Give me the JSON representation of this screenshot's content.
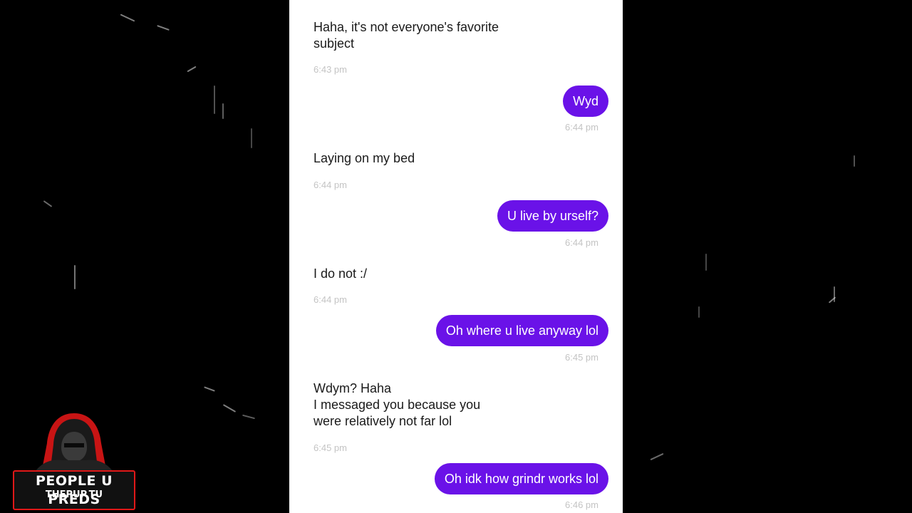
{
  "conversation": {
    "top_time": "",
    "messages": [
      {
        "direction": "in",
        "text": "Haha, it's not everyone's favorite\nsubject",
        "time": "6:43 pm"
      },
      {
        "direction": "out",
        "text": "Wyd",
        "time": "6:44 pm"
      },
      {
        "direction": "in",
        "text": "Laying on my bed",
        "time": "6:44 pm"
      },
      {
        "direction": "out",
        "text": "U live by urself?",
        "time": "6:44 pm"
      },
      {
        "direction": "in",
        "text": "I do not :/",
        "time": "6:44 pm"
      },
      {
        "direction": "out",
        "text": "Oh where u live anyway lol",
        "time": "6:45 pm"
      },
      {
        "direction": "in",
        "text": "Wdym? Haha\nI messaged you because you\nwere relatively not far lol",
        "time": "6:45 pm"
      },
      {
        "direction": "out",
        "text": "Oh idk how grindr works lol",
        "time": "6:46 pm"
      }
    ]
  },
  "colors": {
    "outgoing_bubble": "#6a12e8",
    "incoming_text": "#1a1a1a",
    "timestamp": "#c4c4c4",
    "logo_accent": "#e01818"
  },
  "watermark": {
    "title": "PEOPLE U PREDS",
    "subtitle": "THEPUP.TU",
    "icon": "hooded-figure-icon"
  }
}
